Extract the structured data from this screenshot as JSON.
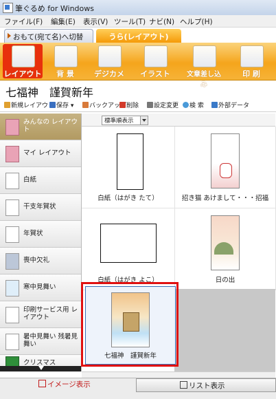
{
  "window": {
    "title": "筆ぐるめ for Windows"
  },
  "menu": [
    "ファイル(F)",
    "編集(E)",
    "表示(V)",
    "ツール(T)",
    "ナビ(N)",
    "ヘルプ(H)"
  ],
  "mode_tabs": {
    "front": "おもて(宛て名)へ切替",
    "back": "うら(レイアウト)"
  },
  "toolbar": [
    "レイアウト",
    "背 景",
    "デジカメ",
    "イラスト",
    "文章差し込み",
    "印 刷"
  ],
  "page_title": "七福神　謹賀新年",
  "actions": [
    "新規レイアウト",
    "保存",
    "バックアップ",
    "削除",
    "設定変更",
    "検 索",
    "外部データ"
  ],
  "sidebar": [
    "みんなの レイアウト",
    "マイ レイアウト",
    "白紙",
    "干支年賀状",
    "年賀状",
    "喪中欠礼",
    "寒中見舞い",
    "印刷サービス用 レイアウト",
    "暑中見舞い 残暑見舞い",
    "クリスマス"
  ],
  "sort": {
    "selected": "標準順表示"
  },
  "layouts": [
    "白紙（はがき たて）",
    "招き猫 あけまして・・・招福",
    "白紙（はがき よこ）",
    "日の出",
    "七福神　謹賀新年"
  ],
  "bottom": {
    "image_view": "イメージ表示",
    "list_view": "リスト表示"
  },
  "colors": {
    "accent": "#f5a51c",
    "selection": "#e01010"
  }
}
